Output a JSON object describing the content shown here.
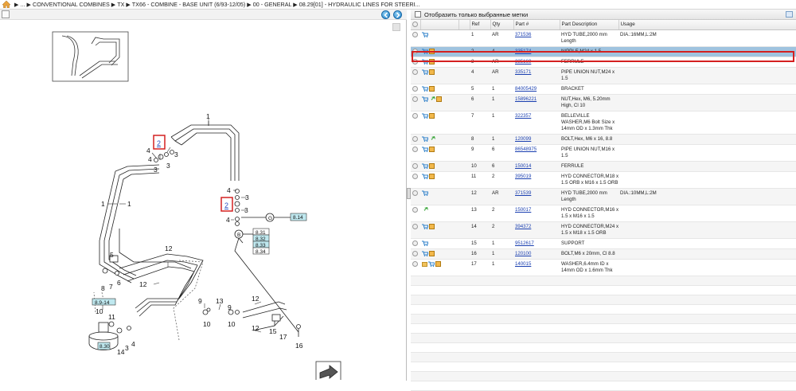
{
  "breadcrumb": {
    "text": "▶ ... ▶ CONVENTIONAL COMBINES ▶ TX ▶ TX66 - COMBINE - BASE UNIT (6/93-12/05) ▶ 00 - GENERAL ▶ 08.29[01] - HYDRAULIC LINES FOR STEERI..."
  },
  "filter": {
    "label": "Отобразить только выбранные метки"
  },
  "table": {
    "headers": [
      "Ref",
      "Qty",
      "Part #",
      "Part Description",
      "Usage"
    ],
    "rows": [
      {
        "ref": "1",
        "qty": "AR",
        "part": "371536",
        "desc": "HYD TUBE,2000 mm Length",
        "usage": "DIA.:16MM,L:2M",
        "icons": [
          "cart"
        ]
      },
      {
        "ref": "2",
        "qty": "4",
        "part": "335174",
        "desc": "NIPPLE,M24 x 1.5",
        "usage": "",
        "icons": [
          "cart",
          "box"
        ],
        "selected": true
      },
      {
        "ref": "3",
        "qty": "AR",
        "part": "335169",
        "desc": "FERRULE",
        "usage": "",
        "icons": [
          "cart",
          "box"
        ]
      },
      {
        "ref": "4",
        "qty": "AR",
        "part": "335171",
        "desc": "PIPE UNION NUT,M24 x 1.5",
        "usage": "",
        "icons": [
          "cart",
          "box"
        ]
      },
      {
        "ref": "5",
        "qty": "1",
        "part": "84005429",
        "desc": "BRACKET",
        "usage": "",
        "icons": [
          "cart",
          "box"
        ]
      },
      {
        "ref": "6",
        "qty": "1",
        "part": "15896221",
        "desc": "NUT,Hex, M6, 5.20mm High, Cl 10",
        "usage": "",
        "icons": [
          "cart",
          "green",
          "box"
        ]
      },
      {
        "ref": "7",
        "qty": "1",
        "part": "322357",
        "desc": "BELLEVILLE WASHER,M6 Bolt Size x 14mm OD x 1.3mm Thk",
        "usage": "",
        "icons": [
          "cart",
          "box"
        ]
      },
      {
        "ref": "8",
        "qty": "1",
        "part": "120099",
        "desc": "BOLT,Hex, M6 x 16, 8.8",
        "usage": "",
        "icons": [
          "cart",
          "green"
        ]
      },
      {
        "ref": "9",
        "qty": "6",
        "part": "86548975",
        "desc": "PIPE UNION NUT,M16 x 1.5",
        "usage": "",
        "icons": [
          "cart",
          "box"
        ]
      },
      {
        "ref": "10",
        "qty": "6",
        "part": "150014",
        "desc": "FERRULE",
        "usage": "",
        "icons": [
          "cart",
          "box"
        ]
      },
      {
        "ref": "11",
        "qty": "2",
        "part": "395019",
        "desc": "HYD CONNECTOR,M18 x 1.5 ORB x M16 x 1.5 ORB",
        "usage": "",
        "icons": [
          "cart",
          "box"
        ]
      },
      {
        "ref": "12",
        "qty": "AR",
        "part": "371539",
        "desc": "HYD TUBE,2000 mm Length",
        "usage": "DIA.:10MM,L:2M",
        "icons": [
          "cart"
        ]
      },
      {
        "ref": "13",
        "qty": "2",
        "part": "150017",
        "desc": "HYD CONNECTOR,M16 x 1.5 x M16 x 1.5",
        "usage": "",
        "icons": [
          "green"
        ]
      },
      {
        "ref": "14",
        "qty": "2",
        "part": "394372",
        "desc": "HYD CONNECTOR,M24 x 1.5 x M18 x 1.5 ORB",
        "usage": "",
        "icons": [
          "cart",
          "box"
        ]
      },
      {
        "ref": "15",
        "qty": "1",
        "part": "9512617",
        "desc": "SUPPORT",
        "usage": "",
        "icons": [
          "cart"
        ]
      },
      {
        "ref": "16",
        "qty": "1",
        "part": "120100",
        "desc": "BOLT,M6 x 20mm, Cl 8.8",
        "usage": "",
        "icons": [
          "cart",
          "box"
        ]
      },
      {
        "ref": "17",
        "qty": "1",
        "part": "140015",
        "desc": "WASHER,6.4mm ID x 14mm OD x 1.6mm Thk",
        "usage": "",
        "icons": [
          "folder",
          "cart",
          "box"
        ]
      }
    ]
  },
  "diagram": {
    "labels": {
      "l1a": "1",
      "l1b": "1",
      "l1c": "1",
      "l2a": "2",
      "l2b": "2",
      "l3a": "3",
      "l3b": "3",
      "l3c": "3",
      "l3d": "3",
      "l4a": "4",
      "l4b": "4",
      "l4c": "4",
      "l4d": "4",
      "l5": "5",
      "l6": "6",
      "l7": "7",
      "l8": "8",
      "l9a": "9",
      "l9b": "9",
      "l10a": "10",
      "l10b": "10",
      "l10c": "10",
      "l11": "11",
      "l12a": "12",
      "l12b": "12",
      "l12c": "12",
      "l12d": "12",
      "l13": "13",
      "l14": "14",
      "l15": "15",
      "l16": "16",
      "l17": "17",
      "lG": "G",
      "lB": "B",
      "r814": "8.14",
      "r831": "8.31",
      "r832": "8.32",
      "r833": "8.33",
      "r834": "8.34",
      "r891": "8.9-14",
      "r830": "8.30"
    }
  }
}
